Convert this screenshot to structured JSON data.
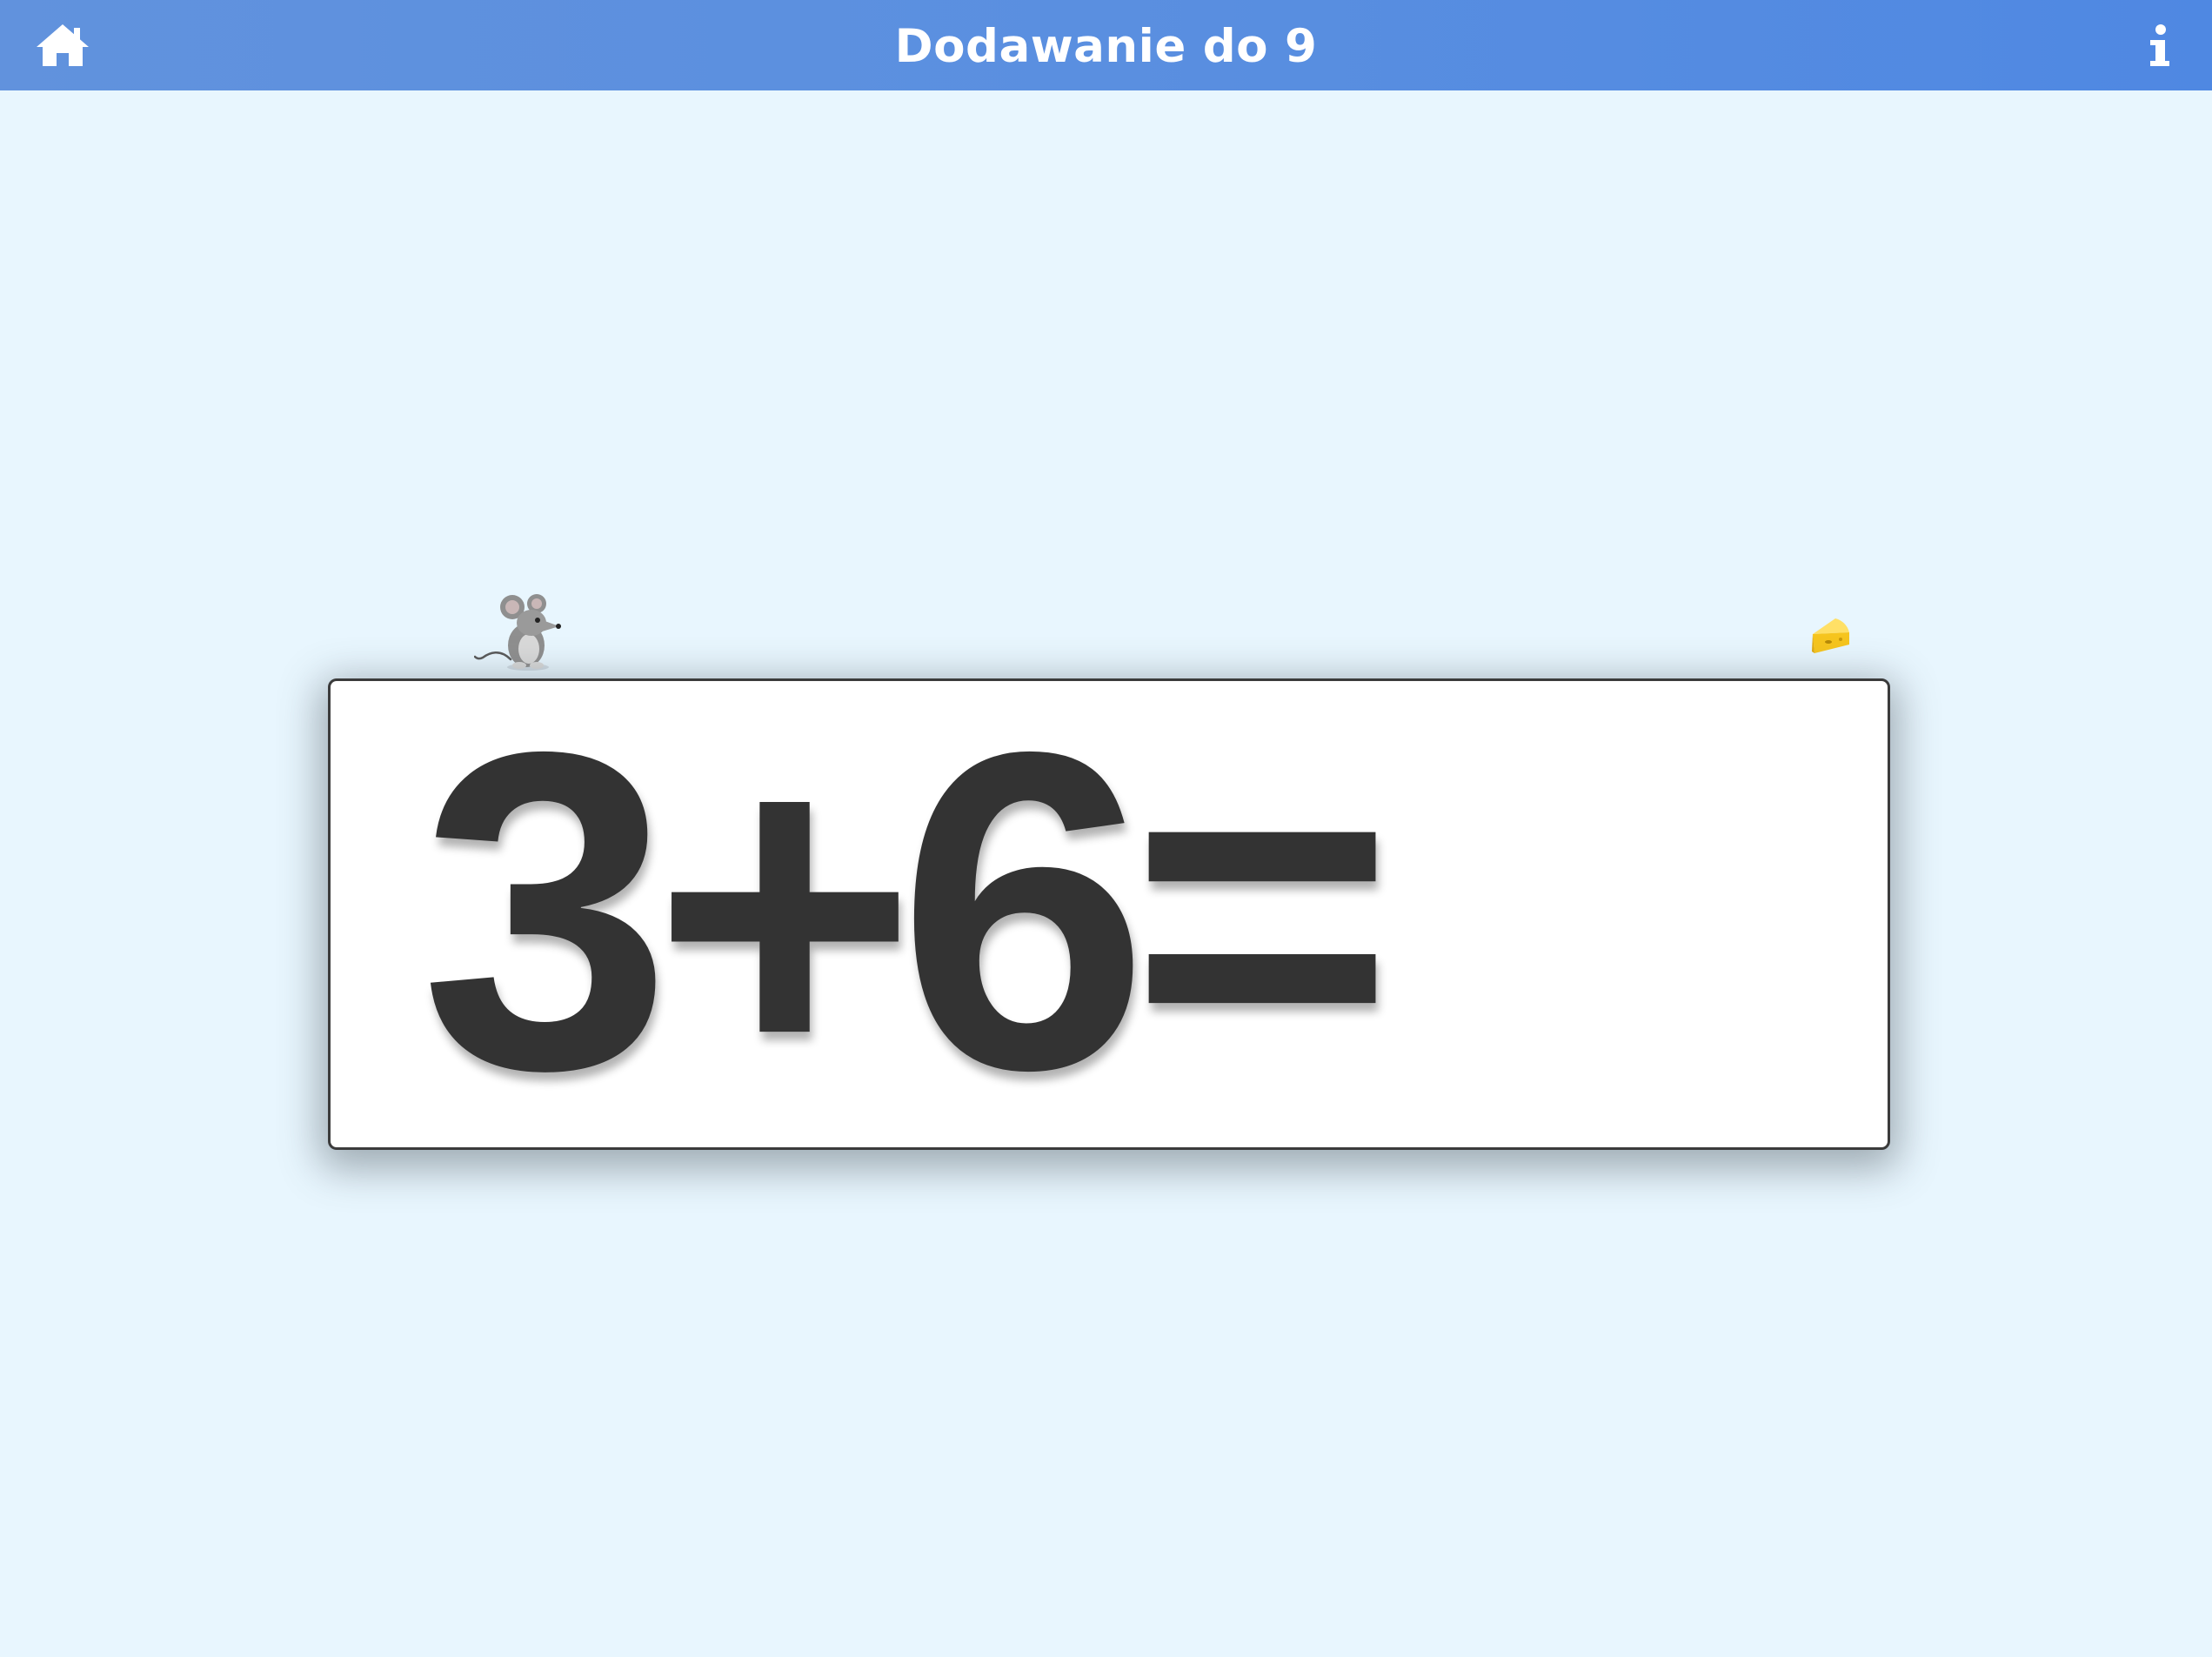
{
  "header": {
    "title": "Dodawanie do 9",
    "home_icon": "home-icon",
    "info_icon": "info-icon",
    "color": "#5a8fe0"
  },
  "decorations": {
    "mouse_icon": "mouse-icon",
    "cheese_icon": "cheese-icon"
  },
  "equation": {
    "first_operand": "3",
    "operator": "+",
    "second_operand": "6",
    "equals": "=",
    "answer": ""
  },
  "colors": {
    "background": "#e8f6fe",
    "card": "#ffffff",
    "text": "#333333"
  }
}
